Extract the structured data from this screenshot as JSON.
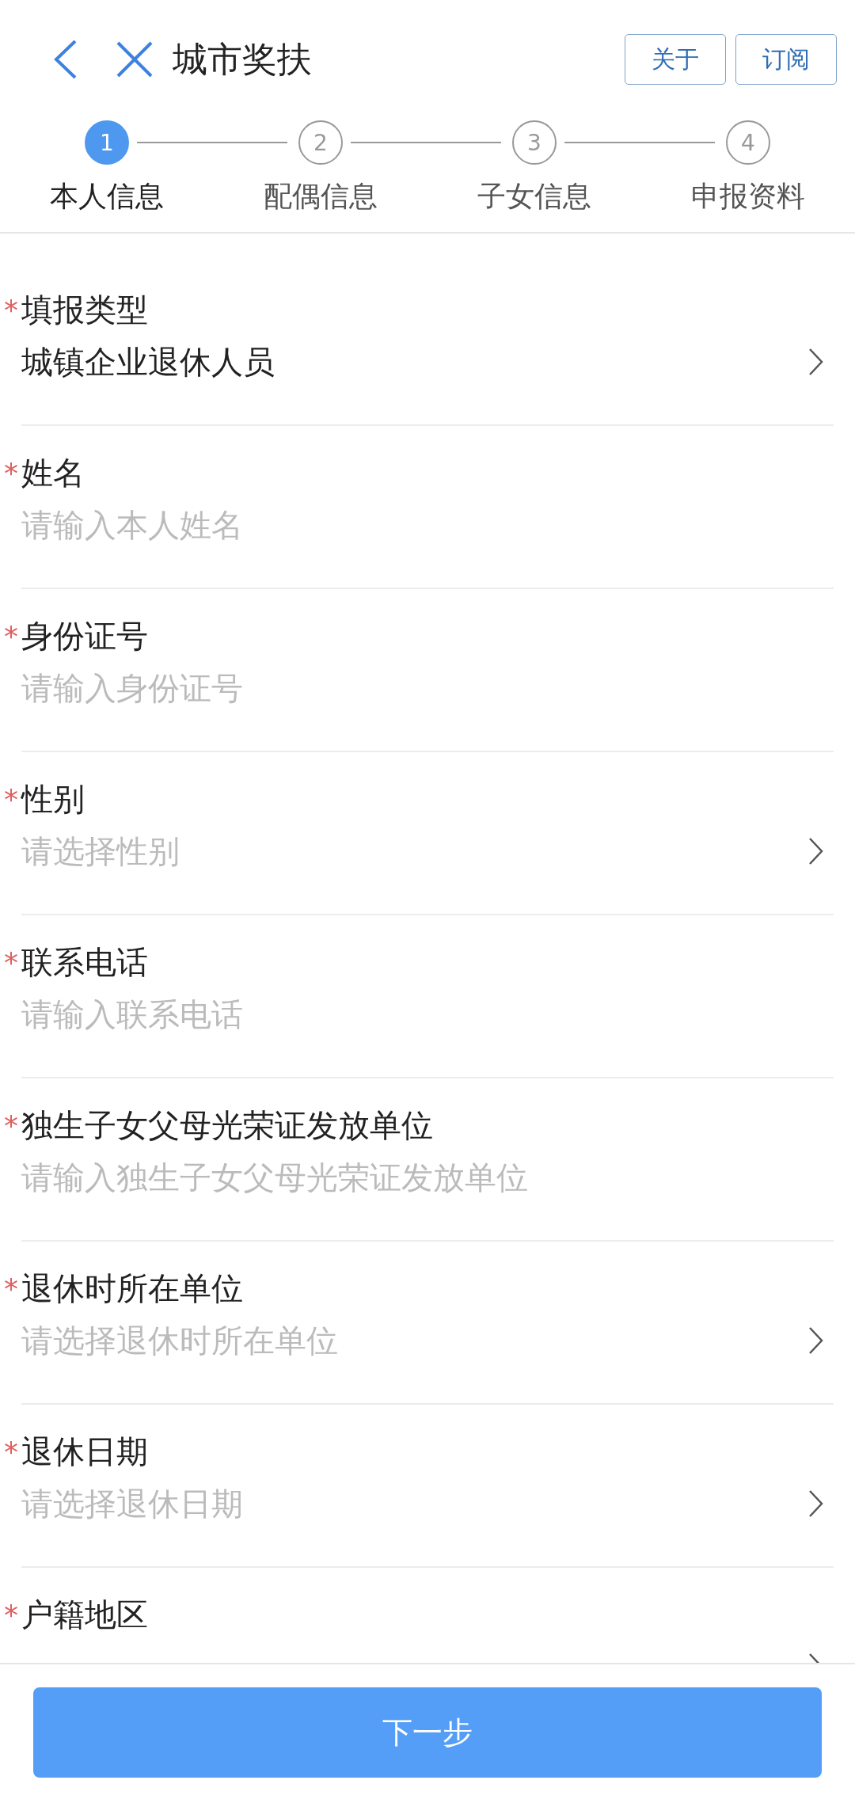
{
  "header": {
    "title": "城市奖扶",
    "buttons": [
      "关于",
      "订阅"
    ]
  },
  "steps": [
    {
      "number": "1",
      "label": "本人信息",
      "selected": true
    },
    {
      "number": "2",
      "label": "配偶信息",
      "selected": false
    },
    {
      "number": "3",
      "label": "子女信息",
      "selected": false
    },
    {
      "number": "4",
      "label": "申报资料",
      "selected": false
    }
  ],
  "fields": [
    {
      "kind": "select",
      "mark": "*",
      "label": "填报类型",
      "value": "城镇企业退休人员"
    },
    {
      "kind": "input",
      "mark": "*",
      "label": "姓名",
      "placeholder": "请输入本人姓名"
    },
    {
      "kind": "input",
      "mark": "*",
      "label": "身份证号",
      "placeholder": "请输入身份证号"
    },
    {
      "kind": "select",
      "mark": "*",
      "label": "性别",
      "placeholder": "请选择性别"
    },
    {
      "kind": "input",
      "mark": "*",
      "label": "联系电话",
      "placeholder": "请输入联系电话"
    },
    {
      "kind": "input",
      "mark": "*",
      "label": "独生子女父母光荣证发放单位",
      "placeholder": "请输入独生子女父母光荣证发放单位"
    },
    {
      "kind": "select",
      "mark": "*",
      "label": "退休时所在单位",
      "placeholder": "请选择退休时所在单位"
    },
    {
      "kind": "select",
      "mark": "*",
      "label": "退休日期",
      "placeholder": "请选择退休日期"
    },
    {
      "kind": "select",
      "mark": "*",
      "label": "户籍地区"
    }
  ],
  "footer": {
    "button": "下一步"
  }
}
